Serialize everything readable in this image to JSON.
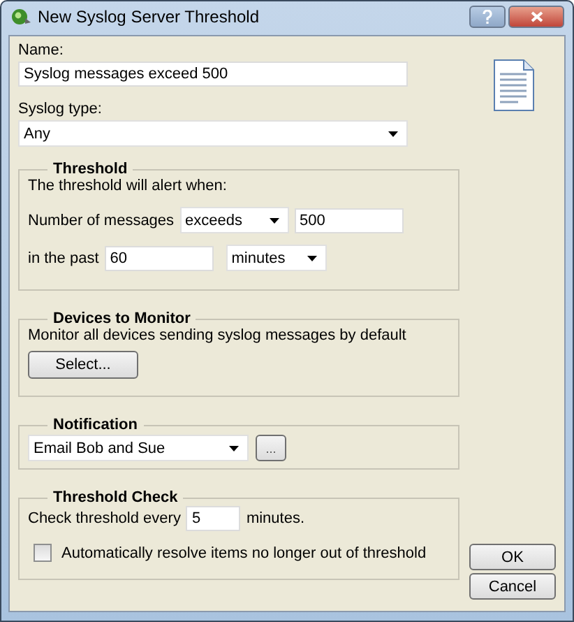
{
  "window": {
    "title": "New Syslog Server Threshold"
  },
  "name": {
    "label": "Name:",
    "value": "Syslog messages exceed 500"
  },
  "syslog_type": {
    "label": "Syslog type:",
    "value": "Any"
  },
  "threshold": {
    "title": "Threshold",
    "intro": "The threshold will alert when:",
    "count_label": "Number of messages",
    "comparison": "exceeds",
    "count": "500",
    "period_label": "in the past",
    "period": "60",
    "unit": "minutes"
  },
  "devices": {
    "title": "Devices to Monitor",
    "description": "Monitor all devices sending syslog messages by default",
    "button": "Select..."
  },
  "notification": {
    "title": "Notification",
    "value": "Email Bob and Sue",
    "button": "..."
  },
  "check": {
    "title": "Threshold Check",
    "label": "Check threshold every",
    "interval": "5",
    "unit_label": "minutes.",
    "auto_resolve": {
      "label": "Automatically resolve items no longer out of threshold",
      "checked": false
    }
  },
  "buttons": [
    "OK",
    "Cancel"
  ]
}
